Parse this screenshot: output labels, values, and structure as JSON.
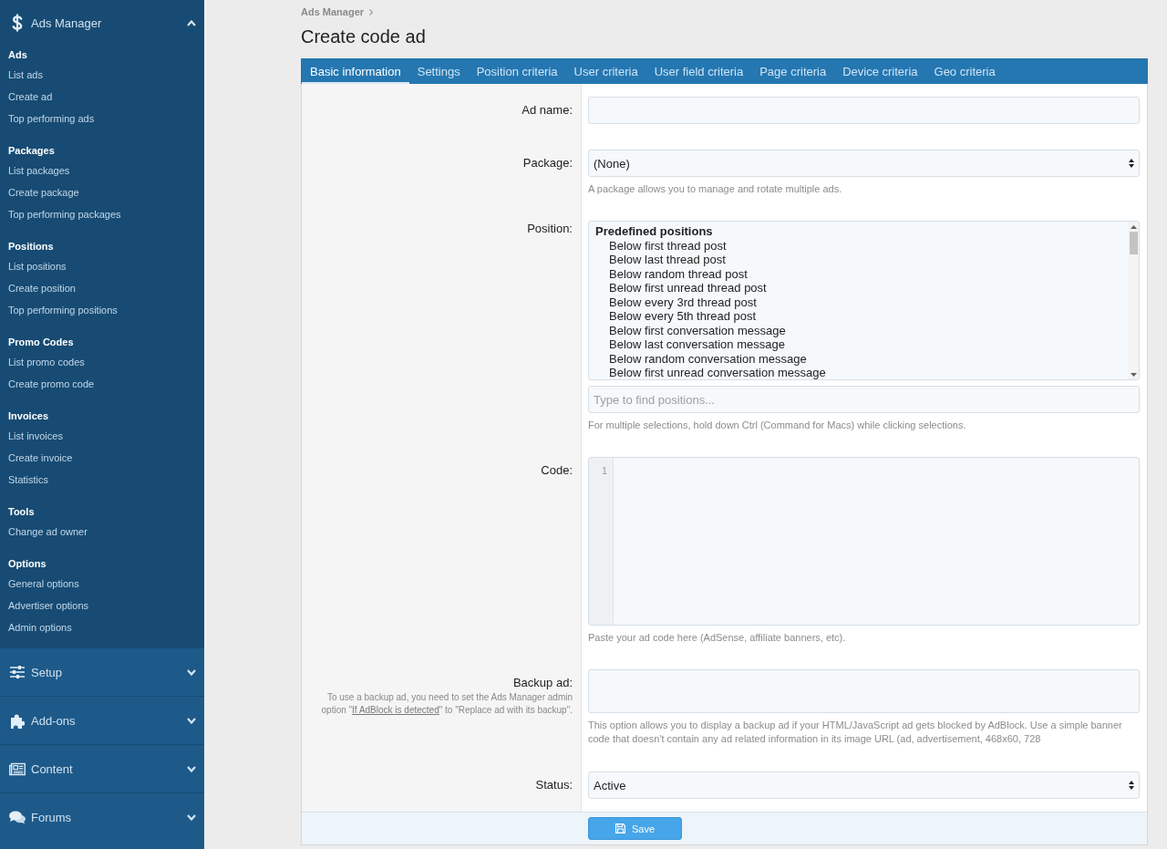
{
  "sidebar": {
    "sections": [
      {
        "title": "Ads Manager",
        "expanded": true,
        "groups": [
          {
            "title": "Ads",
            "links": [
              "List ads",
              "Create ad",
              "Top performing ads"
            ]
          },
          {
            "title": "Packages",
            "links": [
              "List packages",
              "Create package",
              "Top performing packages"
            ]
          },
          {
            "title": "Positions",
            "links": [
              "List positions",
              "Create position",
              "Top performing positions"
            ]
          },
          {
            "title": "Promo Codes",
            "links": [
              "List promo codes",
              "Create promo code"
            ]
          },
          {
            "title": "Invoices",
            "links": [
              "List invoices",
              "Create invoice",
              "Statistics"
            ]
          },
          {
            "title": "Tools",
            "links": [
              "Change ad owner"
            ]
          },
          {
            "title": "Options",
            "links": [
              "General options",
              "Advertiser options",
              "Admin options"
            ]
          }
        ]
      },
      {
        "title": "Setup",
        "expanded": false
      },
      {
        "title": "Add-ons",
        "expanded": false
      },
      {
        "title": "Content",
        "expanded": false
      },
      {
        "title": "Forums",
        "expanded": false
      }
    ]
  },
  "breadcrumb": [
    "Ads Manager"
  ],
  "page_title": "Create code ad",
  "tabs": [
    {
      "label": "Basic information",
      "selected": true
    },
    {
      "label": "Settings",
      "selected": false
    },
    {
      "label": "Position criteria",
      "selected": false
    },
    {
      "label": "User criteria",
      "selected": false
    },
    {
      "label": "User field criteria",
      "selected": false
    },
    {
      "label": "Page criteria",
      "selected": false
    },
    {
      "label": "Device criteria",
      "selected": false
    },
    {
      "label": "Geo criteria",
      "selected": false
    }
  ],
  "form": {
    "rows": [
      {
        "kind": "text",
        "label": "Ad name:"
      },
      {
        "kind": "select",
        "label": "Package:",
        "value": "(None)",
        "hint": "A package allows you to manage and rotate multiple ads."
      },
      {
        "kind": "listbox",
        "label": "Position:",
        "groups": [
          {
            "label": "Predefined positions",
            "options": [
              {
                "label": "Below first thread post",
                "selected": false
              },
              {
                "label": "Below last thread post",
                "selected": false
              },
              {
                "label": "Below random thread post",
                "selected": false
              },
              {
                "label": "Below first unread thread post",
                "selected": false
              },
              {
                "label": "Below every 3rd thread post",
                "selected": false
              },
              {
                "label": "Below every 5th thread post",
                "selected": false
              },
              {
                "label": "Below first conversation message",
                "selected": false
              },
              {
                "label": "Below last conversation message",
                "selected": false
              },
              {
                "label": "Below random conversation message",
                "selected": false
              },
              {
                "label": "Below first unread conversation message",
                "selected": false
              }
            ]
          }
        ],
        "search": {
          "placeholder": "Type to find positions..."
        },
        "hint": "For multiple selections, hold down Ctrl (Command for Macs) while clicking selections."
      },
      {
        "kind": "code",
        "label": "Code:",
        "line_numbers": [
          "1"
        ],
        "hint": "Paste your ad code here (AdSense, affiliate banners, etc)."
      },
      {
        "kind": "textarea",
        "label": "Backup ad:",
        "explain": {
          "before": "To use a backup ad, you need to set the Ads Manager admin option \"",
          "link": "If AdBlock is detected",
          "after": "\" to \"Replace ad with its backup\"."
        },
        "hint": "This option allows you to display a backup ad if your HTML/JavaScript ad gets blocked by AdBlock. Use a simple banner code that doesn't contain any ad related information in its image URL (ad, advertisement, 468x60, 728"
      },
      {
        "kind": "select",
        "label": "Status:",
        "value": "Active"
      }
    ]
  },
  "save_button": {
    "label": "Save"
  }
}
